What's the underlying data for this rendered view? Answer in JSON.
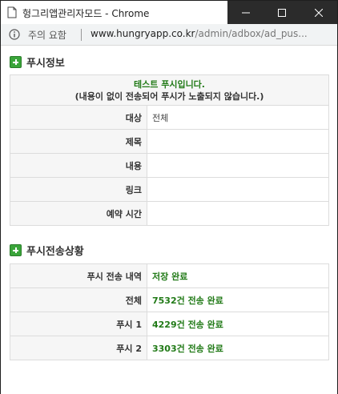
{
  "window": {
    "title": "헝그리앱관리자모드 - Chrome"
  },
  "addressbar": {
    "security_label": "주의 요함",
    "url_host": "www.hungryapp.co.kr",
    "url_path": "/admin/adbox/ad_pus..."
  },
  "push_info": {
    "heading": "푸시정보",
    "notice_line1": "테스트 푸시입니다.",
    "notice_line2": "(내용이 없이 전송되어 푸시가 노출되지 않습니다.)",
    "rows": [
      {
        "label": "대상",
        "value": "전체"
      },
      {
        "label": "제목",
        "value": ""
      },
      {
        "label": "내용",
        "value": ""
      },
      {
        "label": "링크",
        "value": ""
      },
      {
        "label": "예약 시간",
        "value": ""
      }
    ]
  },
  "push_status": {
    "heading": "푸시전송상황",
    "rows": [
      {
        "label": "푸시 전송 내역",
        "value": "저장 완료"
      },
      {
        "label": "전체",
        "value": "7532건 전송 완료"
      },
      {
        "label": "푸시 1",
        "value": "4229건 전송 완료"
      },
      {
        "label": "푸시 2",
        "value": "3303건 전송 완료"
      }
    ]
  },
  "colors": {
    "accent_green": "#217a17",
    "titlebar_controls": "#2b2b2b"
  }
}
